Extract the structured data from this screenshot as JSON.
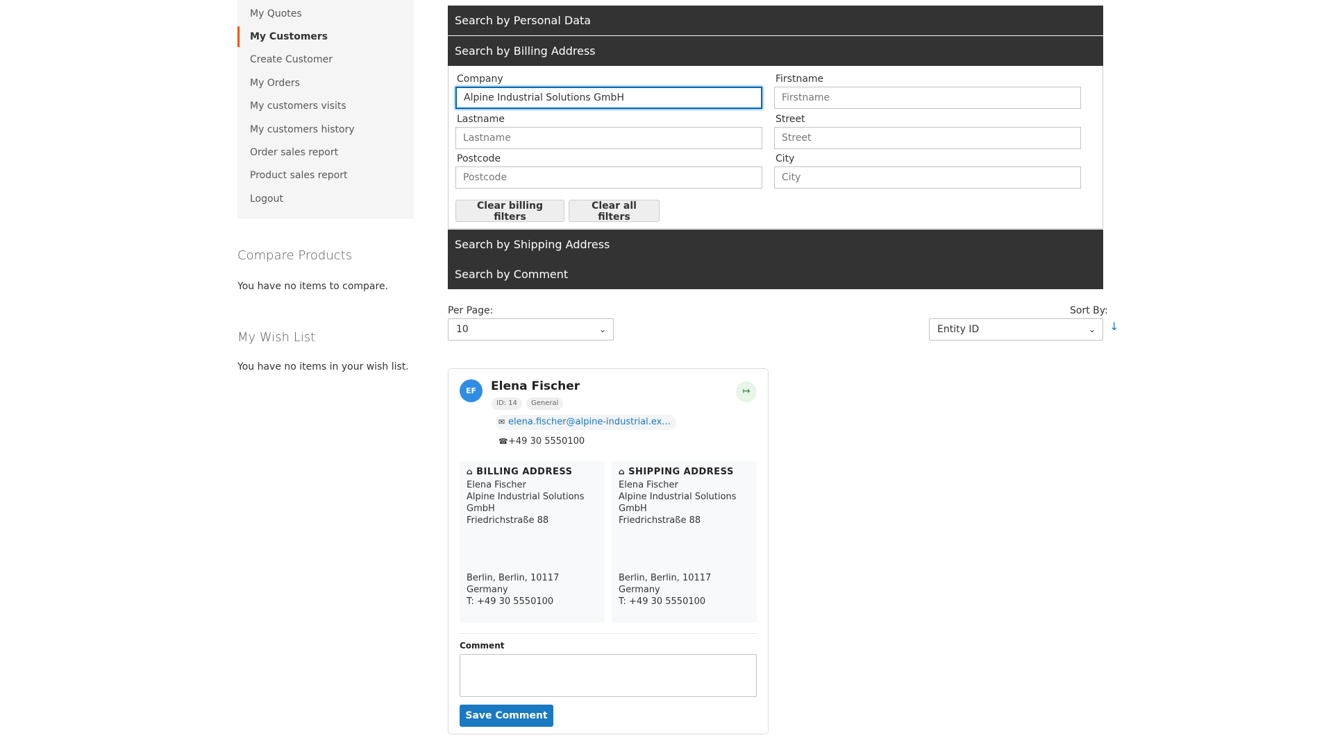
{
  "sidebar": {
    "items": [
      {
        "label": "My Quotes",
        "active": false
      },
      {
        "label": "My Customers",
        "active": true
      },
      {
        "label": "Create Customer",
        "active": false
      },
      {
        "label": "My Orders",
        "active": false
      },
      {
        "label": "My customers visits",
        "active": false
      },
      {
        "label": "My customers history",
        "active": false
      },
      {
        "label": "Order sales report",
        "active": false
      },
      {
        "label": "Product sales report",
        "active": false
      },
      {
        "label": "Logout",
        "active": false
      }
    ],
    "compare": {
      "title": "Compare Products",
      "empty_text": "You have no items to compare."
    },
    "wishlist": {
      "title": "My Wish List",
      "empty_text": "You have no items in your wish list."
    }
  },
  "accordion": {
    "personal": "Search by Personal Data",
    "billing": "Search by Billing Address",
    "shipping": "Search by Shipping Address",
    "comment": "Search by Comment"
  },
  "billing_form": {
    "company": {
      "label": "Company",
      "value": "Alpine Industrial Solutions GmbH"
    },
    "firstname": {
      "label": "Firstname",
      "placeholder": "Firstname"
    },
    "lastname": {
      "label": "Lastname",
      "placeholder": "Lastname"
    },
    "street": {
      "label": "Street",
      "placeholder": "Street"
    },
    "postcode": {
      "label": "Postcode",
      "placeholder": "Postcode"
    },
    "city": {
      "label": "City",
      "placeholder": "City"
    },
    "clear_billing": "Clear billing filters",
    "clear_all": "Clear all filters"
  },
  "toolbar": {
    "per_page_label": "Per Page:",
    "per_page_value": "10",
    "sort_label": "Sort By:",
    "sort_value": "Entity ID",
    "sort_dir_icon": "↓"
  },
  "customer": {
    "initials": "EF",
    "name": "Elena Fischer",
    "id_badge": "ID: 14",
    "group_badge": "General",
    "email": "elena.fischer@alpine-industrial.ex...",
    "phone": "+49 30 5550100",
    "billing": {
      "title": "BILLING ADDRESS",
      "name": "Elena Fischer",
      "company": "Alpine Industrial Solutions GmbH",
      "street": "Friedrichstraße 88",
      "city_line": "Berlin, Berlin, 10117",
      "country": "Germany",
      "phone": "T: +49 30 5550100"
    },
    "shipping": {
      "title": "SHIPPING ADDRESS",
      "name": "Elena Fischer",
      "company": "Alpine Industrial Solutions GmbH",
      "street": "Friedrichstraße 88",
      "city_line": "Berlin, Berlin, 10117",
      "country": "Germany",
      "phone": "T: +49 30 5550100"
    },
    "comment_label": "Comment",
    "save_label": "Save Comment"
  }
}
